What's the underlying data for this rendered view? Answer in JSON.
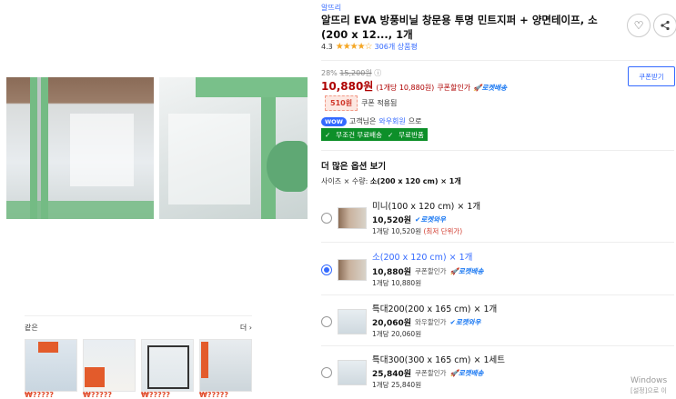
{
  "brand": "알뜨리",
  "title": "알뜨리 EVA 방풍비닐 창문용 투명 민트지퍼 + 양면테이프, 소(200 x 12..., 1개",
  "rating": {
    "score": "4.3",
    "stars": "★★★★☆",
    "reviews": "306개 상품평"
  },
  "pricing": {
    "discount_rate": "28%",
    "original_price": "15,200원",
    "info_icon": "ⓘ",
    "sale_price": "10,880원",
    "unit_price": "(1개당 10,880원)",
    "coupon_discount": "쿠폰할인가",
    "rocket": "로켓배송",
    "coupon_amount": "510원",
    "coupon_applied": "쿠폰 적용됨",
    "coupon_button": "쿠폰받기"
  },
  "wow": {
    "badge": "WOW",
    "text": "고객님은",
    "link": "와우회원",
    "suffix": "으로"
  },
  "shipping": {
    "free": "무조건 무료배송",
    "return": "무료반품"
  },
  "options": {
    "title": "더 많은 옵션 보기",
    "selection_prefix": "사이즈 × 수량:",
    "selection_value": "소(200 x 120 cm) × 1개",
    "items": [
      {
        "name": "미니(100 x 120 cm) × 1개",
        "price": "10,520원",
        "tag": "",
        "badge": "로켓와우",
        "unit": "1개당 10,520원",
        "lowest": "(최저 단위가)"
      },
      {
        "name": "소(200 x 120 cm) × 1개",
        "price": "10,880원",
        "tag": "쿠폰할인가",
        "badge": "로켓배송",
        "unit": "1개당 10,880원",
        "lowest": ""
      },
      {
        "name": "특대200(200 x 165 cm) × 1개",
        "price": "20,060원",
        "tag": "와우할인가",
        "badge": "로켓와우",
        "unit": "1개당 20,060원",
        "lowest": ""
      },
      {
        "name": "특대300(300 x 165 cm) × 1세트",
        "price": "25,840원",
        "tag": "쿠폰할인가",
        "badge": "로켓배송",
        "unit": "1개당 25,840원",
        "lowest": ""
      }
    ]
  },
  "similar": {
    "label": "같은",
    "more": "더 ›",
    "prices": [
      "₩?????",
      "₩?????",
      "₩?????",
      "₩?????"
    ]
  },
  "windows_watermark": {
    "line1": "Windows",
    "line2": "[설정]으로 이"
  },
  "colors": {
    "accent": "#346aff",
    "price_red": "#ae0000",
    "ship_green": "#0d8f29",
    "zip_green": "#74bb84"
  },
  "icons": {
    "wishlist": "♡",
    "share": "share-icon"
  }
}
